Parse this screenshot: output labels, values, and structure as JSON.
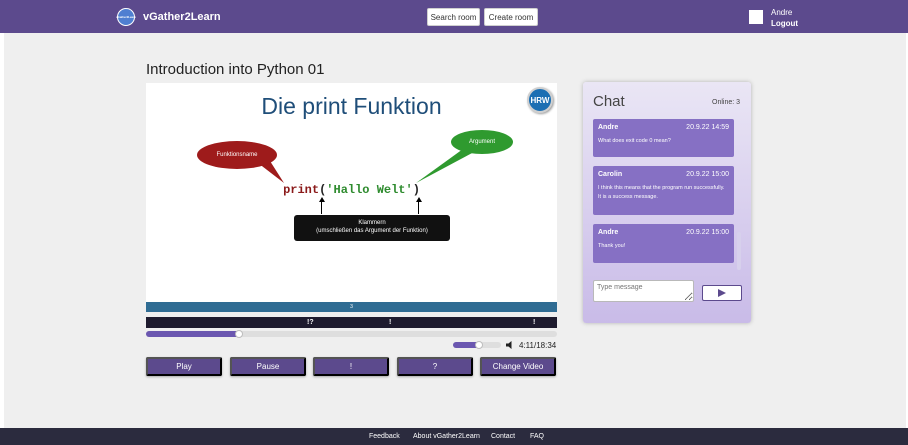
{
  "header": {
    "logo_text": "vGather2Learn",
    "brand": "vGather2Learn",
    "search_room": "Search room",
    "create_room": "Create room",
    "user_name": "Andre",
    "logout": "Logout"
  },
  "page_title": "Introduction into Python 01",
  "video": {
    "slide_title": "Die print Funktion",
    "badge": "HRW",
    "bubble_left": "Funktionsname",
    "bubble_right": "Argument",
    "code_func": "print",
    "code_open": "(",
    "code_arg": "'Hallo Welt'",
    "code_close": ")",
    "box_line1": "Klammern",
    "box_line2": "(umschließen das Argument der Funktion)",
    "slide_number": "3",
    "markers": [
      "!?",
      "!",
      "!"
    ],
    "progress_fraction": 0.2254,
    "volume_fraction": 0.55,
    "time": "4:11/18:34"
  },
  "controls": {
    "play": "Play",
    "pause": "Pause",
    "exclaim": "!",
    "question": "?",
    "change_video": "Change Video"
  },
  "chat": {
    "title": "Chat",
    "online": "Online: 3",
    "messages": [
      {
        "author": "Andre",
        "time": "20.9.22 14:59",
        "text": "What does exit code 0 mean?"
      },
      {
        "author": "Carolin",
        "time": "20.9.22 15:00",
        "text": "I think this means that the program run successfully. It is a success message."
      },
      {
        "author": "Andre",
        "time": "20.9.22 15:00",
        "text": "Thank you!"
      }
    ],
    "input_placeholder": "Type message"
  },
  "footer": {
    "feedback": "Feedback",
    "about": "About vGather2Learn",
    "contact": "Contact",
    "faq": "FAQ"
  },
  "colors": {
    "primary": "#5c4a8d",
    "accent": "#6b57b0",
    "footer": "#2b2b3e",
    "background": "#efefef"
  }
}
